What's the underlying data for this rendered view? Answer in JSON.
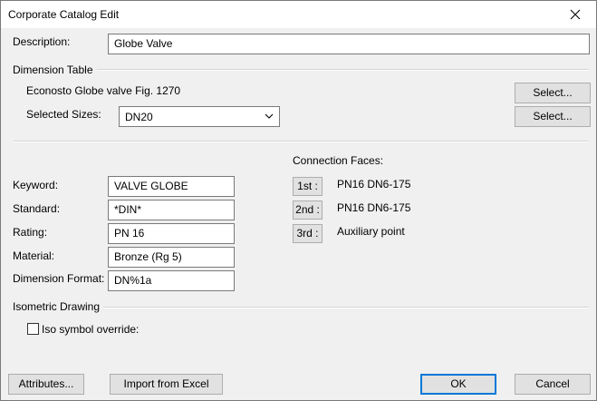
{
  "window": {
    "title": "Corporate Catalog Edit"
  },
  "description": {
    "label": "Description:",
    "value": "Globe Valve"
  },
  "dimension_table": {
    "group_title": "Dimension Table",
    "table_name": "Econosto Globe valve Fig. 1270",
    "select_label": "Select...",
    "selected_sizes_label": "Selected Sizes:",
    "selected_sizes_value": "DN20",
    "select_sizes_label": "Select..."
  },
  "properties": {
    "keyword": {
      "label": "Keyword:",
      "value": "VALVE GLOBE"
    },
    "standard": {
      "label": "Standard:",
      "value": "*DIN*"
    },
    "rating": {
      "label": "Rating:",
      "value": "PN 16"
    },
    "material": {
      "label": "Material:",
      "value": "Bronze (Rg 5)"
    },
    "dimension_format": {
      "label": "Dimension Format:",
      "value": "DN%1a"
    }
  },
  "connection_faces": {
    "title": "Connection Faces:",
    "items": [
      {
        "button": "1st :",
        "value": "PN16 DN6-175"
      },
      {
        "button": "2nd :",
        "value": "PN16 DN6-175"
      },
      {
        "button": "3rd :",
        "value": "Auxiliary point"
      }
    ]
  },
  "isometric": {
    "group_title": "Isometric Drawing",
    "iso_override_label": "Iso symbol override:",
    "iso_override_checked": false
  },
  "footer": {
    "attributes_label": "Attributes...",
    "import_label": "Import from Excel",
    "ok_label": "OK",
    "cancel_label": "Cancel"
  },
  "icons": {
    "close": "close-icon",
    "dropdown": "chevron-down-icon"
  },
  "colors": {
    "accent": "#0078d7",
    "window_bg": "#f0f0f0",
    "titlebar_bg": "#ffffff"
  }
}
